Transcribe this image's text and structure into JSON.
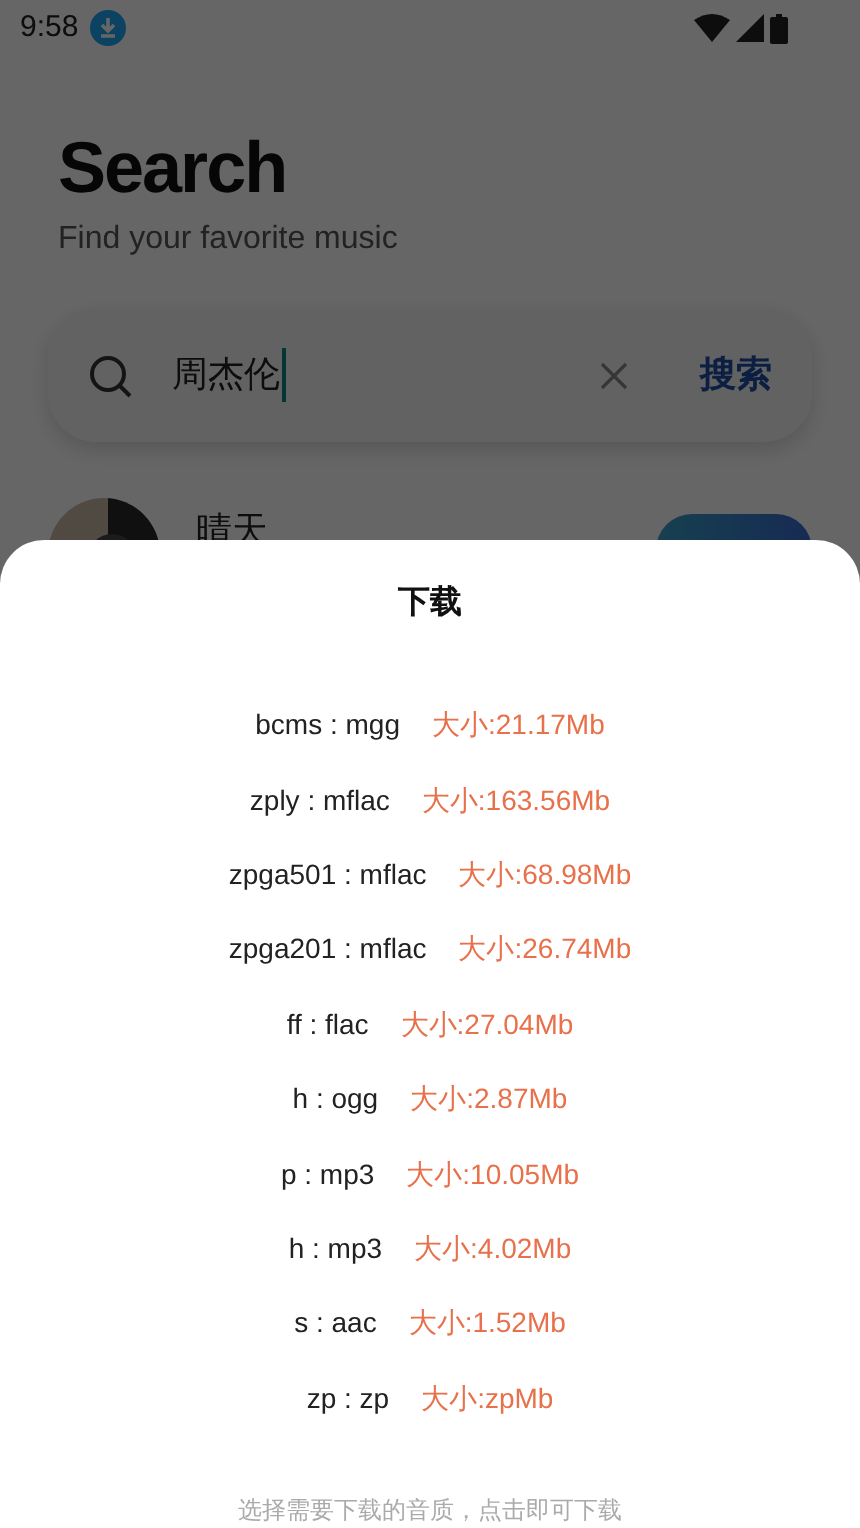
{
  "status_bar": {
    "time": "9:58"
  },
  "header": {
    "title": "Search",
    "subtitle": "Find your favorite music"
  },
  "search": {
    "value": "周杰伦",
    "button": "搜索"
  },
  "results": [
    {
      "title": "晴天"
    }
  ],
  "download_sheet": {
    "title": "下载",
    "options": [
      {
        "quality": "bcms : mgg",
        "size": "大小:21.17Mb"
      },
      {
        "quality": "zply : mflac",
        "size": "大小:163.56Mb"
      },
      {
        "quality": "zpga501 : mflac",
        "size": "大小:68.98Mb"
      },
      {
        "quality": "zpga201 : mflac",
        "size": "大小:26.74Mb"
      },
      {
        "quality": "ff : flac",
        "size": "大小:27.04Mb"
      },
      {
        "quality": "h : ogg",
        "size": "大小:2.87Mb"
      },
      {
        "quality": "p : mp3",
        "size": "大小:10.05Mb"
      },
      {
        "quality": "h : mp3",
        "size": "大小:4.02Mb"
      },
      {
        "quality": "s : aac",
        "size": "大小:1.52Mb"
      },
      {
        "quality": "zp : zp",
        "size": "大小:zpMb"
      }
    ],
    "hint": "选择需要下载的音质，点击即可下载"
  }
}
